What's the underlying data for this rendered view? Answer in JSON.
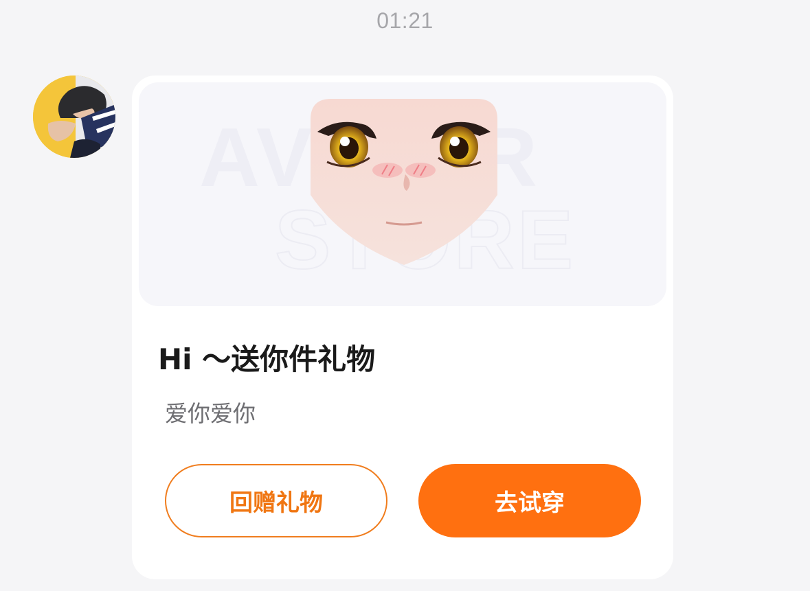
{
  "timestamp": "01:21",
  "message": {
    "watermark": {
      "line1": "AVATAR",
      "line2": "STORE"
    },
    "title": "Hi ～送你件礼物",
    "subtitle": "爱你爱你",
    "buttons": {
      "return_gift": "回赠礼物",
      "try_on": "去试穿"
    }
  },
  "colors": {
    "accent": "#ff7010",
    "page_bg": "#f5f5f7",
    "card_bg": "#ffffff"
  },
  "icons": {
    "avatar": "user-avatar-photo",
    "gift_preview": "anime-face-icon"
  }
}
